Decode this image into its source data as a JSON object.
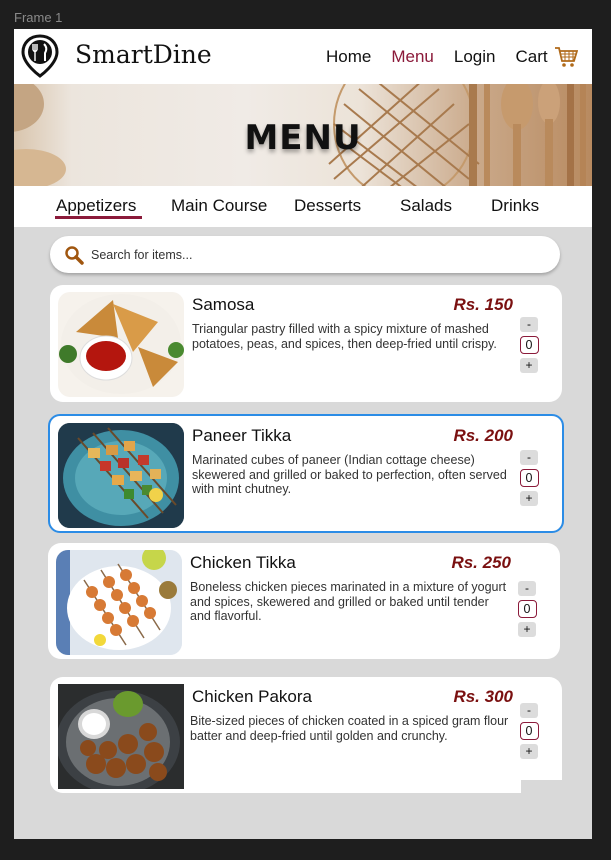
{
  "frame_label": "Frame 1",
  "brand": {
    "name": "SmartDine"
  },
  "nav": {
    "items": [
      "Home",
      "Menu",
      "Login",
      "Cart"
    ],
    "active": "Menu"
  },
  "hero": {
    "title": "MENU"
  },
  "tabs": {
    "items": [
      "Appetizers",
      "Main Course",
      "Desserts",
      "Salads",
      "Drinks"
    ],
    "active": "Appetizers"
  },
  "search": {
    "placeholder": "Search for items..."
  },
  "items": [
    {
      "name": "Samosa",
      "price": "Rs. 150",
      "description": "Triangular pastry filled with a spicy mixture of mashed potatoes, peas, and spices, then deep-fried until crispy.",
      "qty": "0",
      "minus": "-",
      "plus": "+"
    },
    {
      "name": "Paneer Tikka",
      "price": "Rs. 200",
      "description": "Marinated cubes of paneer (Indian cottage cheese) skewered and grilled or baked to perfection, often served with mint chutney.",
      "qty": "0",
      "minus": "-",
      "plus": "+"
    },
    {
      "name": "Chicken Tikka",
      "price": "Rs. 250",
      "description": "Boneless chicken pieces marinated in a mixture of yogurt and spices, skewered and grilled or baked until tender and flavorful.",
      "qty": "0",
      "minus": "-",
      "plus": "+"
    },
    {
      "name": "Chicken Pakora",
      "price": "Rs. 300",
      "description": "Bite-sized pieces of chicken coated in a spiced gram flour batter and deep-fried until golden and crunchy.",
      "qty": "0",
      "minus": "-",
      "plus": "+"
    }
  ],
  "colors": {
    "accent": "#8b1a3a",
    "price": "#7a1010",
    "selection": "#2b8ce6",
    "background": "#d9d9d9"
  }
}
